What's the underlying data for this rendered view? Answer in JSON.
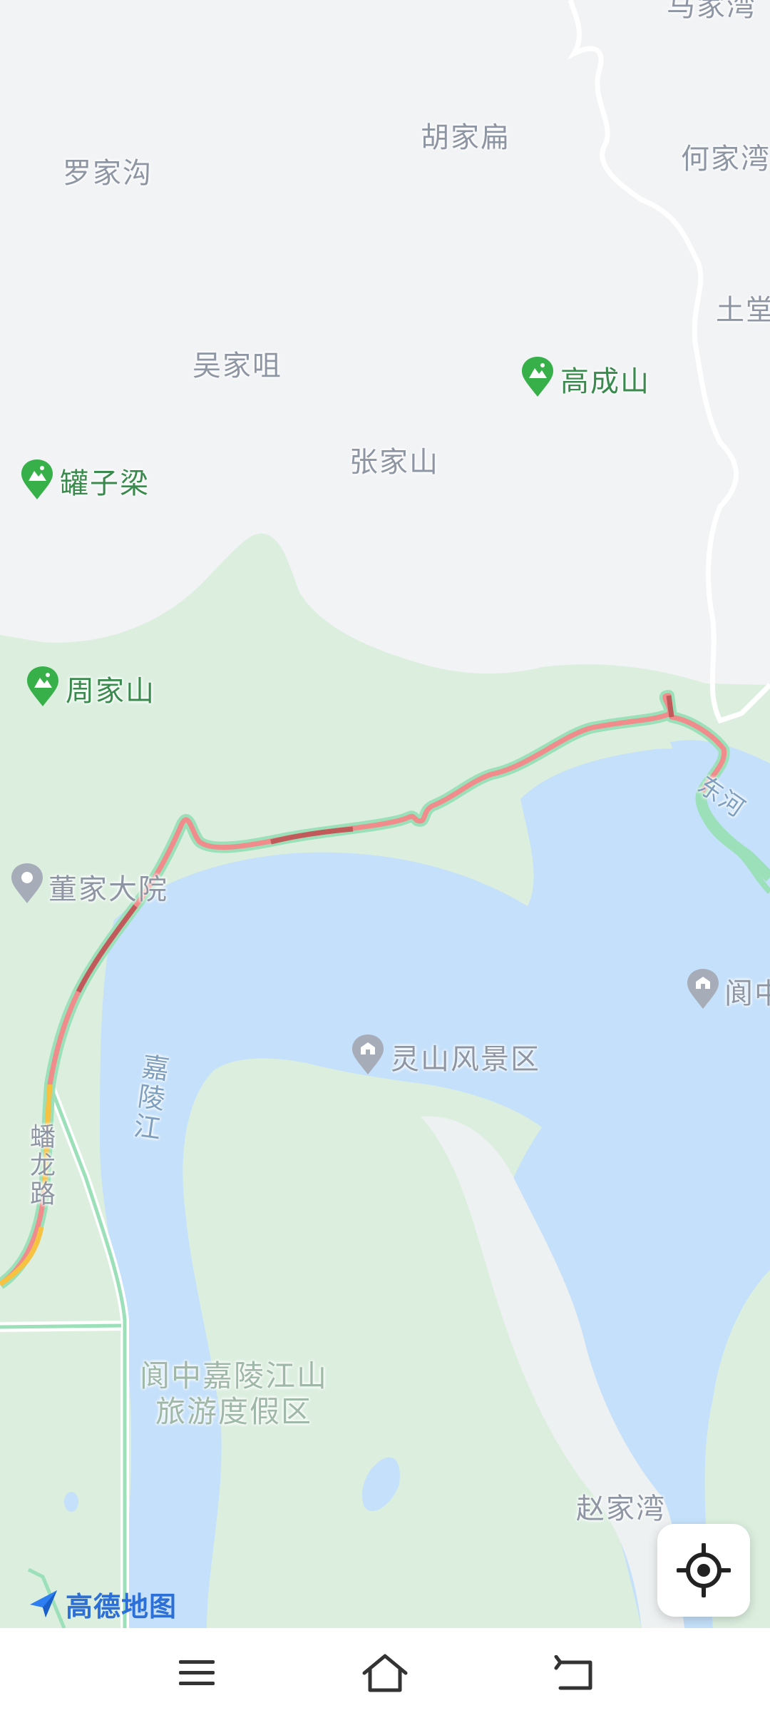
{
  "map": {
    "places": {
      "luojiagou": "罗家沟",
      "hujiabian": "胡家扁",
      "hejiawan": "何家湾",
      "majiawan": "马家湾",
      "tutang": "土堂",
      "wujiazui": "吴家咀",
      "zhangjiashan": "张家山",
      "dongjiayuan": "董家大院",
      "zhaojiawan": "赵家湾"
    },
    "mountains": {
      "gaochengshan": "高成山",
      "guanziliang": "罐子梁",
      "zhoujiashan": "周家山"
    },
    "poi": {
      "lingshan": "灵山风景区",
      "langzhong": "阆中"
    },
    "river": {
      "jialingjiang": "嘉陵江",
      "donghe": "东河"
    },
    "road": {
      "panlonglu": "蟠龙路"
    },
    "resort": {
      "line1": "阆中嘉陵江山",
      "line2": "旅游度假区"
    },
    "logo_text": "高德地图"
  },
  "colors": {
    "land": "#f2f3f5",
    "green_area": "#dcefdf",
    "water": "#c4e0fa",
    "route_red": "#f08c8c",
    "route_dark": "#c15a5a",
    "route_green": "#9be0b8"
  },
  "icons": {
    "locate": "locate-crosshair-icon",
    "menu": "menu-icon",
    "home": "home-icon",
    "back": "back-icon"
  }
}
